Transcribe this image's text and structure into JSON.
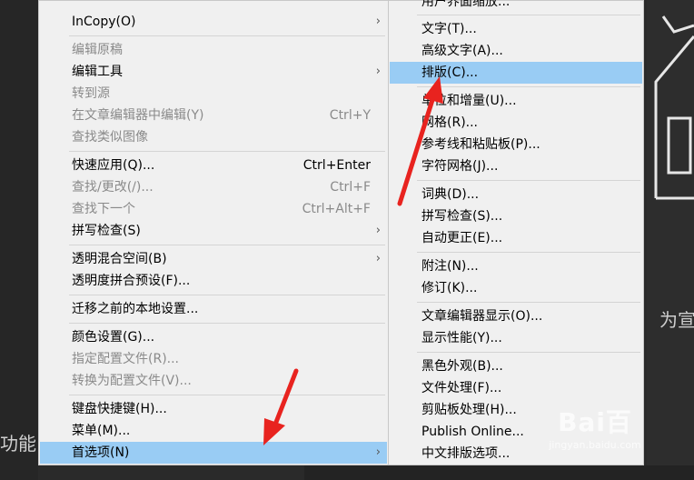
{
  "background": {
    "left_text": "功能",
    "right_text": "为宣"
  },
  "main_menu": {
    "items": [
      {
        "label": "InCopy(O)",
        "shortcut": "",
        "submenu": true,
        "disabled": false,
        "highlight": false
      },
      {
        "label": "编辑原稿",
        "shortcut": "",
        "submenu": false,
        "disabled": true,
        "highlight": false
      },
      {
        "label": "编辑工具",
        "shortcut": "",
        "submenu": true,
        "disabled": false,
        "highlight": false
      },
      {
        "label": "转到源",
        "shortcut": "",
        "submenu": false,
        "disabled": true,
        "highlight": false
      },
      {
        "label": "在文章编辑器中编辑(Y)",
        "shortcut": "Ctrl+Y",
        "submenu": false,
        "disabled": true,
        "highlight": false
      },
      {
        "label": "查找类似图像",
        "shortcut": "",
        "submenu": false,
        "disabled": true,
        "highlight": false
      },
      {
        "label": "快速应用(Q)...",
        "shortcut": "Ctrl+Enter",
        "submenu": false,
        "disabled": false,
        "highlight": false
      },
      {
        "label": "查找/更改(/)...",
        "shortcut": "Ctrl+F",
        "submenu": false,
        "disabled": true,
        "highlight": false
      },
      {
        "label": "查找下一个",
        "shortcut": "Ctrl+Alt+F",
        "submenu": false,
        "disabled": true,
        "highlight": false
      },
      {
        "label": "拼写检查(S)",
        "shortcut": "",
        "submenu": true,
        "disabled": false,
        "highlight": false
      },
      {
        "label": "透明混合空间(B)",
        "shortcut": "",
        "submenu": true,
        "disabled": false,
        "highlight": false
      },
      {
        "label": "透明度拼合预设(F)...",
        "shortcut": "",
        "submenu": false,
        "disabled": false,
        "highlight": false
      },
      {
        "label": "迁移之前的本地设置...",
        "shortcut": "",
        "submenu": false,
        "disabled": false,
        "highlight": false
      },
      {
        "label": "颜色设置(G)...",
        "shortcut": "",
        "submenu": false,
        "disabled": false,
        "highlight": false
      },
      {
        "label": "指定配置文件(R)...",
        "shortcut": "",
        "submenu": false,
        "disabled": true,
        "highlight": false
      },
      {
        "label": "转换为配置文件(V)...",
        "shortcut": "",
        "submenu": false,
        "disabled": true,
        "highlight": false
      },
      {
        "label": "键盘快捷键(H)...",
        "shortcut": "",
        "submenu": false,
        "disabled": false,
        "highlight": false
      },
      {
        "label": "菜单(M)...",
        "shortcut": "",
        "submenu": false,
        "disabled": false,
        "highlight": false
      },
      {
        "label": "首选项(N)",
        "shortcut": "",
        "submenu": true,
        "disabled": false,
        "highlight": true
      }
    ]
  },
  "sub_menu": {
    "items": [
      {
        "label": "用户界面缩放...",
        "highlight": false
      },
      {
        "label": "文字(T)...",
        "highlight": false
      },
      {
        "label": "高级文字(A)...",
        "highlight": false
      },
      {
        "label": "排版(C)...",
        "highlight": true
      },
      {
        "label": "单位和增量(U)...",
        "highlight": false
      },
      {
        "label": "网格(R)...",
        "highlight": false
      },
      {
        "label": "参考线和粘贴板(P)...",
        "highlight": false
      },
      {
        "label": "字符网格(J)...",
        "highlight": false
      },
      {
        "label": "词典(D)...",
        "highlight": false
      },
      {
        "label": "拼写检查(S)...",
        "highlight": false
      },
      {
        "label": "自动更正(E)...",
        "highlight": false
      },
      {
        "label": "附注(N)...",
        "highlight": false
      },
      {
        "label": "修订(K)...",
        "highlight": false
      },
      {
        "label": "文章编辑器显示(O)...",
        "highlight": false
      },
      {
        "label": "显示性能(Y)...",
        "highlight": false
      },
      {
        "label": "黑色外观(B)...",
        "highlight": false
      },
      {
        "label": "文件处理(F)...",
        "highlight": false
      },
      {
        "label": "剪贴板处理(H)...",
        "highlight": false
      },
      {
        "label": "Publish Online...",
        "highlight": false
      },
      {
        "label": "中文排版选项...",
        "highlight": false
      }
    ]
  },
  "watermark": {
    "logo": "Bai百",
    "url": "jingyan.baidu.com"
  },
  "colors": {
    "highlight": "#99ccf4",
    "annotation_arrow": "#e8231f",
    "menu_bg": "#f0f0f0"
  }
}
